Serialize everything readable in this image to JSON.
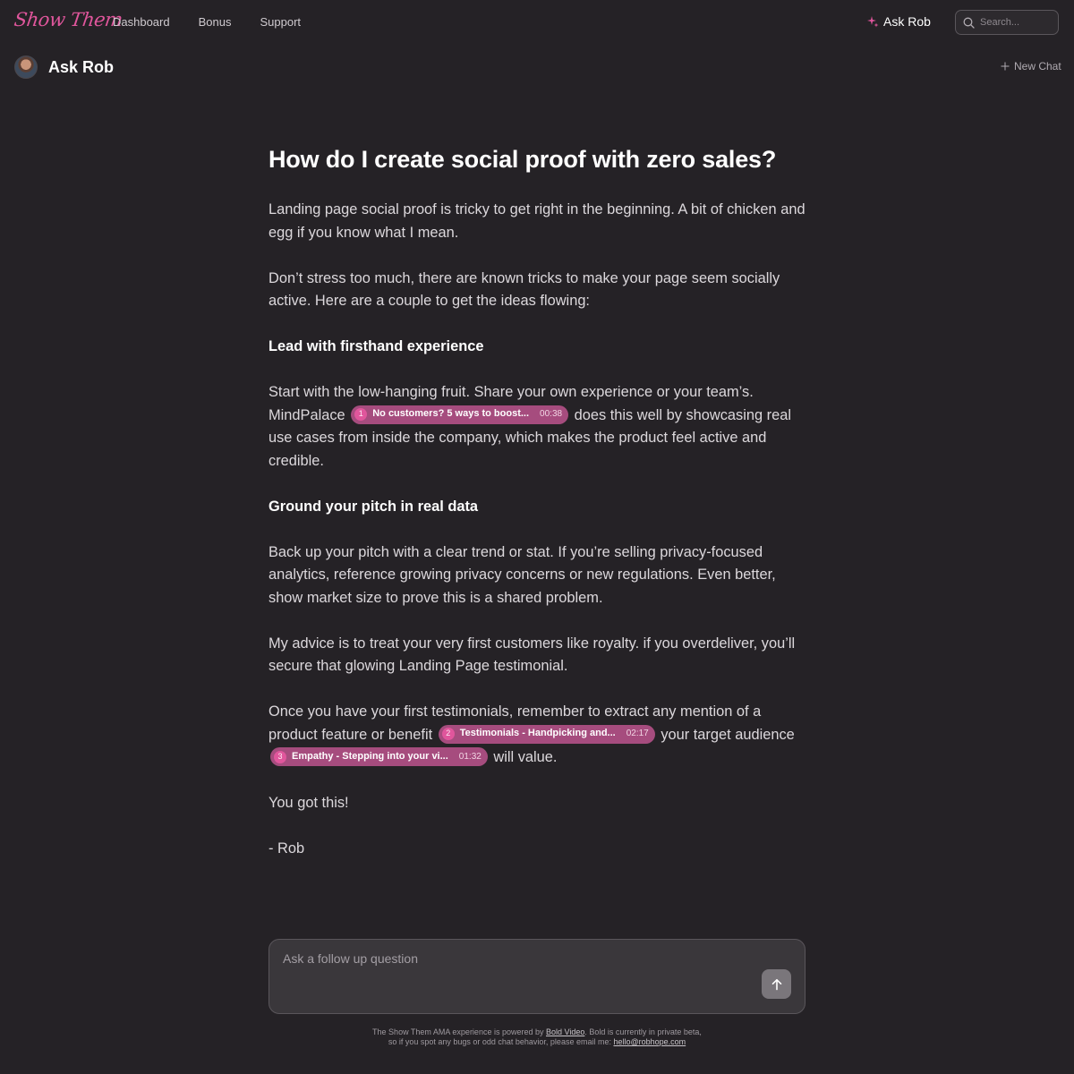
{
  "nav": {
    "logo": "Show Them",
    "links": [
      "Dashboard",
      "Bonus",
      "Support"
    ],
    "ask_rob": "Ask Rob",
    "search_placeholder": "Search..."
  },
  "header": {
    "title": "Ask Rob",
    "new_chat": "New Chat"
  },
  "chat": {
    "question": "How do I create social proof with zero sales?",
    "p1": "Landing page social proof is tricky to get right in the beginning. A bit of chicken and egg if you know what I mean.",
    "p2": "Don’t stress too much, there are known tricks to make your page seem socially active. Here are a couple to get the ideas flowing:",
    "h1": "Lead with firsthand experience",
    "p3_a": "Start with the low-hanging fruit. Share your own experience or your team’s. MindPalace",
    "p3_b": "does this well by showcasing real use cases from inside the company, which makes the product feel active and credible.",
    "h2": "Ground your pitch in real data",
    "p4": "Back up your pitch with a clear trend or stat. If you’re selling privacy-focused analytics, reference growing privacy concerns or new regulations. Even better, show market size to prove this is a shared problem.",
    "p5": "My advice is to treat your very first customers like royalty. if you overdeliver, you’ll secure that glowing Landing Page testimonial.",
    "p6_a": "Once you have your first testimonials, remember to extract any mention of a product feature or benefit",
    "p6_b": "your target audience",
    "p6_c": "will value.",
    "p7": "You got this!",
    "sign": "- Rob",
    "chips": [
      {
        "num": "1",
        "title": "No customers? 5 ways to boost...",
        "time": "00:38"
      },
      {
        "num": "2",
        "title": "Testimonials - Handpicking and...",
        "time": "02:17"
      },
      {
        "num": "3",
        "title": "Empathy - Stepping into your vi...",
        "time": "01:32"
      }
    ]
  },
  "input": {
    "placeholder": "Ask a follow up question"
  },
  "footer": {
    "line1_a": "The Show Them AMA experience is powered by",
    "link1": "Bold Video",
    "line1_b": ". Bold is currently in private beta,",
    "line2_a": "so if you spot any bugs or odd chat behavior, please email me:",
    "link2": "hello@robhope.com"
  },
  "colors": {
    "background": "#252226",
    "accent": "#e0569c",
    "chip": "#a64c7e"
  }
}
